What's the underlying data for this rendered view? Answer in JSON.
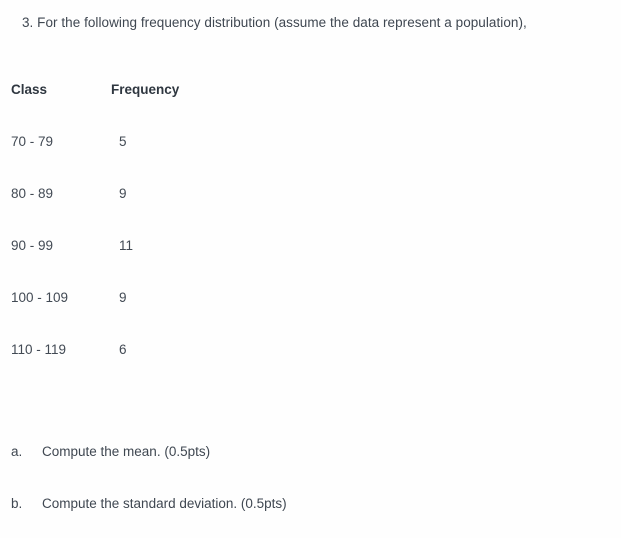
{
  "question": {
    "prompt": "3. For the following frequency distribution (assume the data represent a population),"
  },
  "table": {
    "headers": {
      "class": "Class",
      "frequency": "Frequency"
    },
    "rows": [
      {
        "class": "70 - 79",
        "frequency": "5"
      },
      {
        "class": "80 - 89",
        "frequency": "9"
      },
      {
        "class": "90 - 99",
        "frequency": "11"
      },
      {
        "class": "100 - 109",
        "frequency": "9"
      },
      {
        "class": "110 - 119",
        "frequency": "6"
      }
    ]
  },
  "subitems": [
    {
      "marker": "a.",
      "text": "Compute the mean. (0.5pts)"
    },
    {
      "marker": "b.",
      "text": "Compute the standard deviation. (0.5pts)"
    }
  ],
  "colors": {
    "background": "#fefefe",
    "body_text": "#3f4751",
    "header_text": "#2f3740"
  }
}
